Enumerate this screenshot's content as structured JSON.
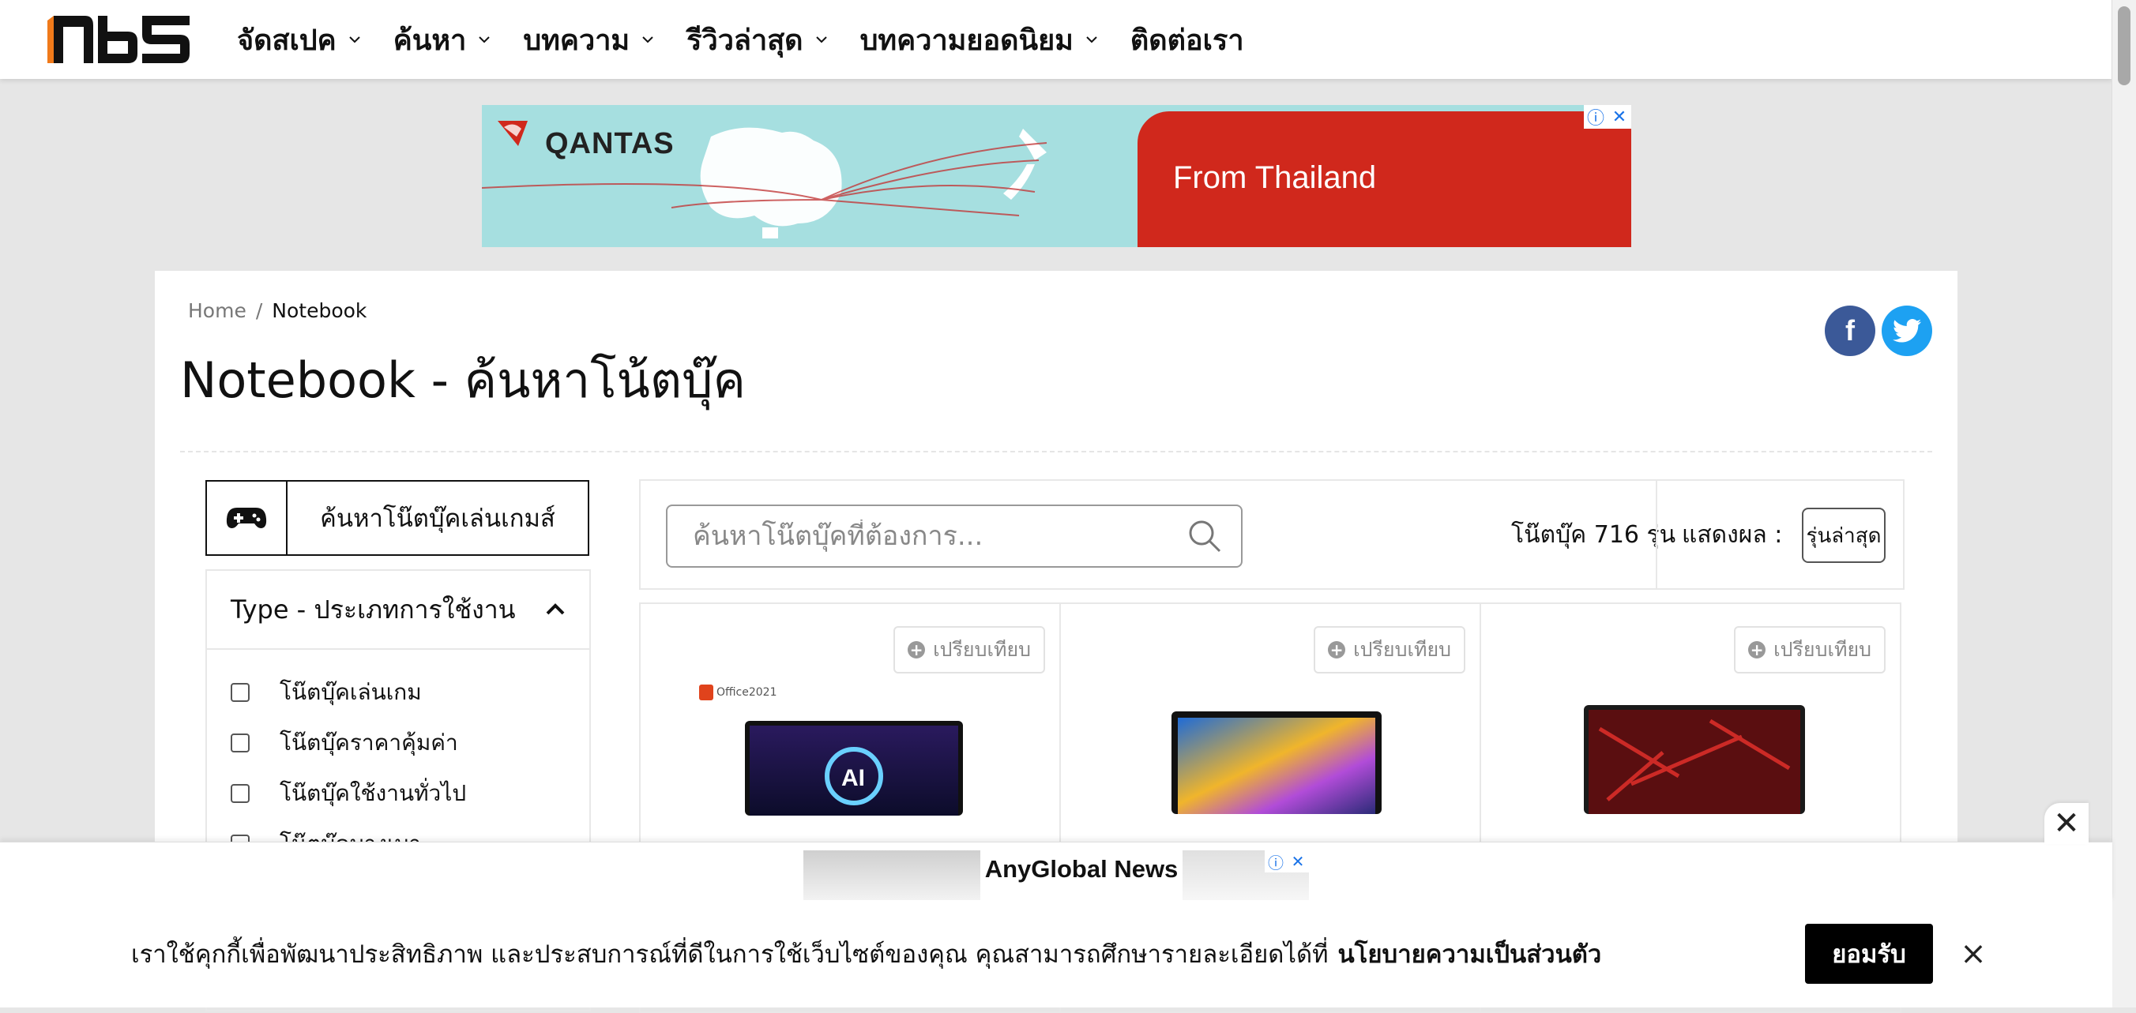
{
  "nav": {
    "logo": "nbs",
    "items": [
      {
        "label": "จัดสเปค",
        "has_dropdown": true
      },
      {
        "label": "ค้นหา",
        "has_dropdown": true
      },
      {
        "label": "บทความ",
        "has_dropdown": true
      },
      {
        "label": "รีวิวล่าสุด",
        "has_dropdown": true
      },
      {
        "label": "บทความยอดนิยม",
        "has_dropdown": true
      },
      {
        "label": "ติดต่อเรา",
        "has_dropdown": false
      }
    ]
  },
  "top_ad": {
    "brand": "QANTAS",
    "text": "From Thailand",
    "info_icon": "info-icon",
    "close_icon": "close-icon",
    "colors": {
      "sky": "#a6dfe0",
      "red": "#d0281c"
    }
  },
  "breadcrumb": {
    "home": "Home",
    "separator": "/",
    "current": "Notebook"
  },
  "page_title": "Notebook - ค้นหาโน้ตบุ๊ค",
  "social": {
    "facebook": "f",
    "twitter": "twitter-icon",
    "colors": {
      "facebook": "#3b5998",
      "twitter": "#1da1f2"
    }
  },
  "sidebar": {
    "gaming_button": {
      "label": "ค้นหาโน๊ตบุ๊คเล่นเกมส์",
      "icon": "gamepad-icon"
    },
    "filter": {
      "title": "Type - ประเภทการใช้งาน",
      "expanded": true,
      "options": [
        {
          "label": "โน๊ตบุ๊คเล่นเกม",
          "checked": false
        },
        {
          "label": "โน๊ตบุ๊คราคาคุ้มค่า",
          "checked": false
        },
        {
          "label": "โน๊ตบุ๊คใช้งานทั่วไป",
          "checked": false
        },
        {
          "label": "โน๊ตบุ๊คบางเบา",
          "checked": false
        }
      ]
    }
  },
  "results": {
    "search_placeholder": "ค้นหาโน๊ตบุ๊คที่ต้องการ...",
    "search_value": "",
    "count_label": "โน๊ตบุ๊ค 716 รุ่น",
    "sort_label": "แสดงผล :",
    "sort_value": "รุ่นล่าสุด",
    "products": [
      {
        "compare_label": "เปรียบเทียบ",
        "badge": "Office2021",
        "image": "laptop-ai-screen"
      },
      {
        "compare_label": "เปรียบเทียบ",
        "badge": "",
        "image": "laptop-zenbook-screen"
      },
      {
        "compare_label": "เปรียบเทียบ",
        "badge": "",
        "image": "laptop-rog-screen"
      }
    ]
  },
  "bottom_ad": {
    "title": "AnyGlobal News",
    "close_icon": "close-icon"
  },
  "cookie": {
    "text": "เราใช้คุกกี้เพื่อพัฒนาประสิทธิภาพ และประสบการณ์ที่ดีในการใช้เว็บไซต์ของคุณ คุณสามารถศึกษารายละเอียดได้ที่",
    "link": "นโยบายความเป็นส่วนตัว",
    "accept": "ยอมรับ",
    "close": "×"
  }
}
